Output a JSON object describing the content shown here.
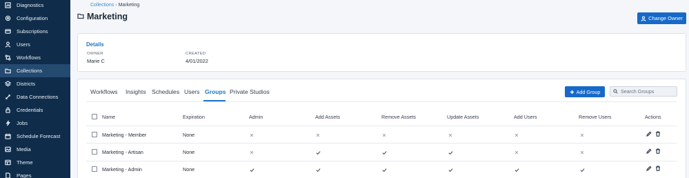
{
  "sidebar": {
    "items": [
      {
        "label": "Diagnostics",
        "icon": "chart-icon",
        "active": false
      },
      {
        "label": "Configuration",
        "icon": "gear-icon",
        "active": false
      },
      {
        "label": "Subscriptions",
        "icon": "subscription-icon",
        "active": false
      },
      {
        "label": "Users",
        "icon": "user-icon",
        "active": false
      },
      {
        "label": "Workflows",
        "icon": "workflow-icon",
        "active": false
      },
      {
        "label": "Collections",
        "icon": "folder-icon",
        "active": true
      },
      {
        "label": "Districts",
        "icon": "layers-icon",
        "active": false
      },
      {
        "label": "Data Connections",
        "icon": "connection-icon",
        "active": false
      },
      {
        "label": "Credentials",
        "icon": "lock-icon",
        "active": false
      },
      {
        "label": "Jobs",
        "icon": "jobs-icon",
        "active": false
      },
      {
        "label": "Schedule Forecast",
        "icon": "calendar-icon",
        "active": false
      },
      {
        "label": "Media",
        "icon": "media-icon",
        "active": false
      },
      {
        "label": "Theme",
        "icon": "theme-icon",
        "active": false
      },
      {
        "label": "Pages",
        "icon": "pages-icon",
        "active": false
      }
    ]
  },
  "breadcrumb": {
    "parent": "Collections",
    "separator": "›",
    "current": "Marketing"
  },
  "page": {
    "title": "Marketing",
    "change_owner_label": "Change Owner"
  },
  "details": {
    "title": "Details",
    "owner_label": "OWNER",
    "owner_value": "Marie C",
    "created_label": "CREATED",
    "created_value": "4/01/2022"
  },
  "tabs": [
    {
      "label": "Workflows",
      "active": false
    },
    {
      "label": "Insights",
      "active": false
    },
    {
      "label": "Schedules",
      "active": false
    },
    {
      "label": "Users",
      "active": false
    },
    {
      "label": "Groups",
      "active": true
    },
    {
      "label": "Private Studios",
      "active": false
    }
  ],
  "groups": {
    "add_label": "Add Group",
    "search_placeholder": "Search Groups",
    "columns": [
      "Name",
      "Expiration",
      "Admin",
      "Add Assets",
      "Remove Assets",
      "Update Assets",
      "Add Users",
      "Remove Users",
      "Actions"
    ],
    "rows": [
      {
        "name": "Marketing - Member",
        "expiration": "None",
        "perms": [
          false,
          false,
          false,
          false,
          false,
          false
        ]
      },
      {
        "name": "Marketing - Artisan",
        "expiration": "None",
        "perms": [
          false,
          true,
          true,
          true,
          false,
          false
        ]
      },
      {
        "name": "Marketing - Admin",
        "expiration": "None",
        "perms": [
          true,
          true,
          true,
          true,
          true,
          true
        ]
      }
    ]
  },
  "colors": {
    "sidebar_bg": "#0f2d4b",
    "sidebar_active": "#254a70",
    "primary": "#1769c9",
    "accent_text": "#1e76c3"
  }
}
